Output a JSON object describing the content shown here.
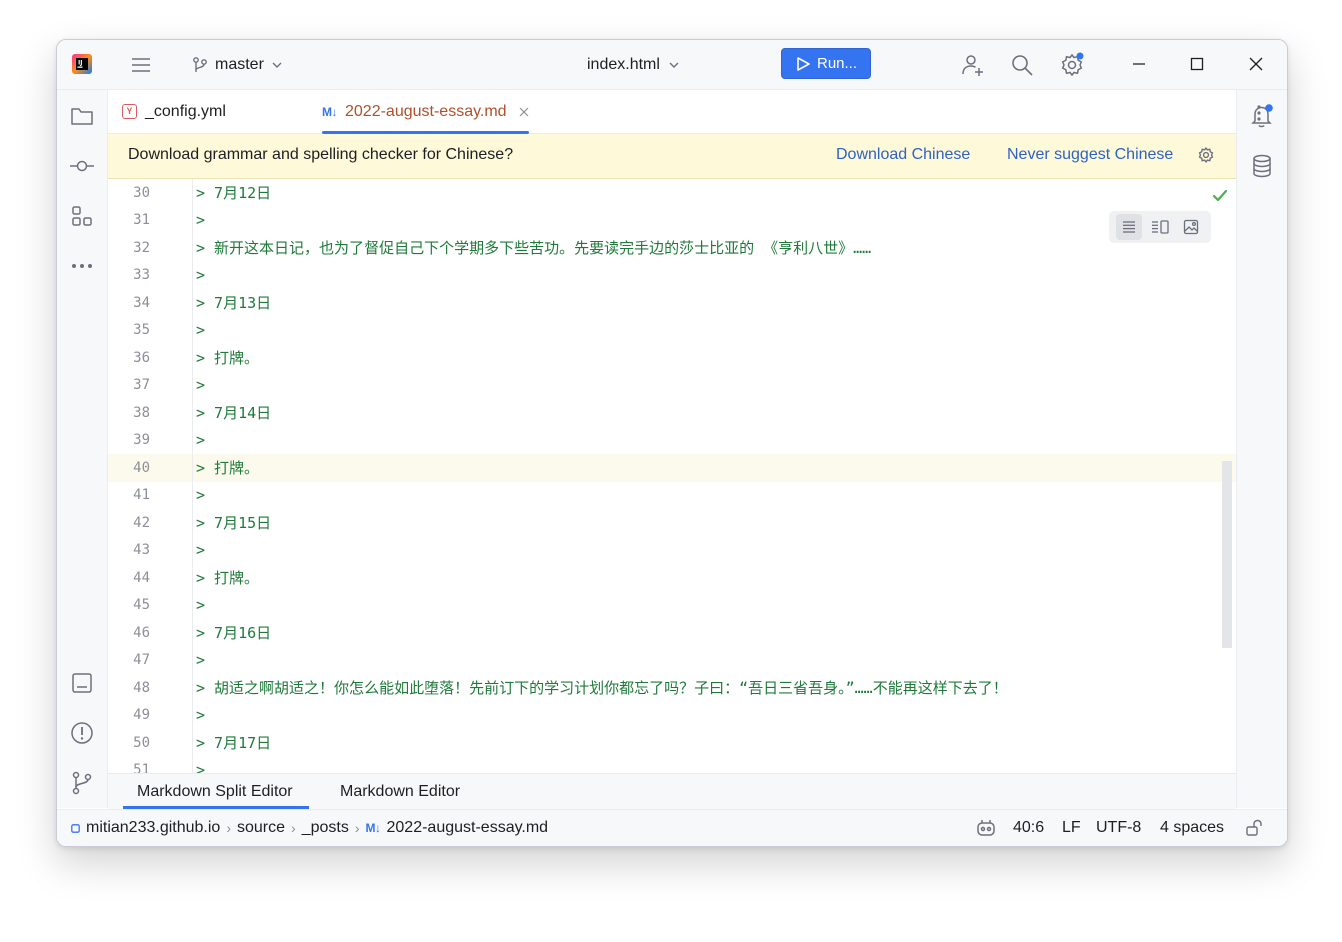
{
  "titlebar": {
    "branch": "master",
    "file": "index.html",
    "run_label": "Run..."
  },
  "tabs": [
    {
      "label": "_config.yml",
      "icon": "yaml-file-icon",
      "active": false
    },
    {
      "label": "2022-august-essay.md",
      "icon": "markdown-file-icon",
      "badge": "M↓",
      "active": true
    }
  ],
  "banner": {
    "message": "Download grammar and spelling checker for Chinese?",
    "download_link": "Download Chinese",
    "never_link": "Never suggest Chinese"
  },
  "editor": {
    "current_line": 40,
    "lines": [
      {
        "n": "30",
        "text": "> 7月12日"
      },
      {
        "n": "31",
        "text": ">"
      },
      {
        "n": "32",
        "text": "> 新开这本日记，也为了督促自己下个学期多下些苦功。先要读完手边的莎士比亚的 《亨利八世》……"
      },
      {
        "n": "33",
        "text": ">"
      },
      {
        "n": "34",
        "text": "> 7月13日"
      },
      {
        "n": "35",
        "text": ">"
      },
      {
        "n": "36",
        "text": "> 打牌。"
      },
      {
        "n": "37",
        "text": ">"
      },
      {
        "n": "38",
        "text": "> 7月14日"
      },
      {
        "n": "39",
        "text": ">"
      },
      {
        "n": "40",
        "text": "> 打牌。"
      },
      {
        "n": "41",
        "text": ">"
      },
      {
        "n": "42",
        "text": "> 7月15日"
      },
      {
        "n": "43",
        "text": ">"
      },
      {
        "n": "44",
        "text": "> 打牌。"
      },
      {
        "n": "45",
        "text": ">"
      },
      {
        "n": "46",
        "text": "> 7月16日"
      },
      {
        "n": "47",
        "text": ">"
      },
      {
        "n": "48",
        "text": "> 胡适之啊胡适之！你怎么能如此堕落！先前订下的学习计划你都忘了吗？子曰：“吾日三省吾身。”……不能再这样下去了！"
      },
      {
        "n": "49",
        "text": ">"
      },
      {
        "n": "50",
        "text": "> 7月17日"
      },
      {
        "n": "51",
        "text": ">"
      }
    ]
  },
  "bottom_tabs": [
    {
      "label": "Markdown Split Editor",
      "active": true
    },
    {
      "label": "Markdown Editor",
      "active": false
    }
  ],
  "statusbar": {
    "project": "mitian233.github.io",
    "path1": "source",
    "path2": "_posts",
    "file_badge": "M↓",
    "file": "2022-august-essay.md",
    "position": "40:6",
    "line_ending": "LF",
    "encoding": "UTF-8",
    "indent": "4 spaces"
  },
  "colors": {
    "accent": "#3574f0",
    "code_green": "#1f7a3a",
    "banner_bg": "#fdf9d9",
    "current_line_bg": "#fcfaed"
  }
}
